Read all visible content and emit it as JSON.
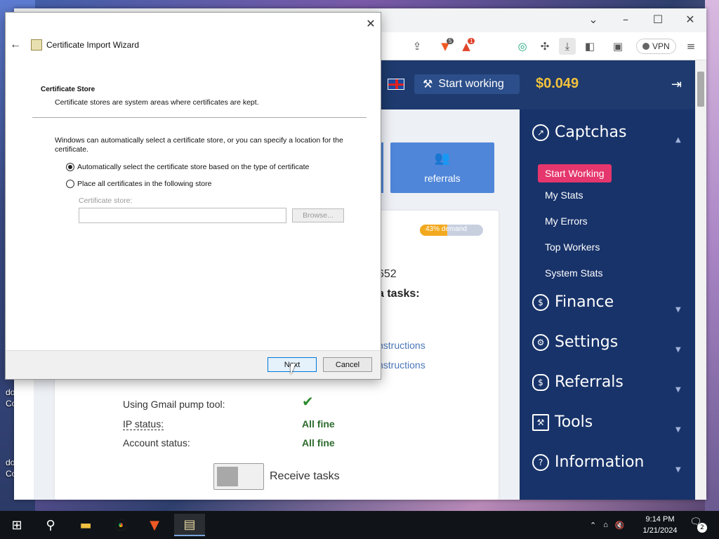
{
  "desktop": {
    "labels": [
      "do",
      "Co",
      "do",
      "Co"
    ]
  },
  "browser": {
    "window_controls": {
      "minimize": "–",
      "maximize": "☐",
      "close": "✕"
    },
    "toolbar": {
      "brave_badge": "5",
      "alert_badge": "1",
      "vpn_label": "VPN"
    }
  },
  "site": {
    "header": {
      "start_working": "Start working",
      "balance": "$0.049"
    },
    "tile": {
      "label": "referrals"
    },
    "demand": {
      "label": "43% demand",
      "fraction": 0.43
    },
    "main": {
      "partial_number": "652",
      "partial_tasks": "a tasks:",
      "links": [
        "nstructions",
        "nstructions"
      ],
      "status": [
        {
          "label": "Using Gmail pump tool:",
          "value": ""
        },
        {
          "label": "IP status:",
          "value": "All fine"
        },
        {
          "label": "Account status:",
          "value": "All fine"
        }
      ],
      "receive_tasks": "Receive tasks"
    },
    "sidebar": {
      "captchas": "Captchas",
      "captchas_items": {
        "start_working": "Start Working",
        "my_stats": "My Stats",
        "my_errors": "My Errors",
        "top_workers": "Top Workers",
        "system_stats": "System Stats"
      },
      "finance": "Finance",
      "settings": "Settings",
      "referrals": "Referrals",
      "tools": "Tools",
      "information": "Information"
    }
  },
  "dialog": {
    "title": "Certificate Import Wizard",
    "heading": "Certificate Store",
    "subheading": "Certificate stores are system areas where certificates are kept.",
    "body": "Windows can automatically select a certificate store, or you can specify a location for the certificate.",
    "option_auto": "Automatically select the certificate store based on the type of certificate",
    "option_manual": "Place all certificates in the following store",
    "store_label": "Certificate store:",
    "store_value": "",
    "browse": "Browse...",
    "next": "Next",
    "cancel": "Cancel"
  },
  "taskbar": {
    "time": "9:14 PM",
    "date": "1/21/2024",
    "notifications": "2"
  },
  "colors": {
    "sidebar_bg": "#18336a",
    "header_bg": "#1e3a6e",
    "accent_pink": "#e5366d",
    "balance_gold": "#f3c23b",
    "tile_blue": "#4f86d9",
    "ok_green": "#2d6b2d"
  }
}
